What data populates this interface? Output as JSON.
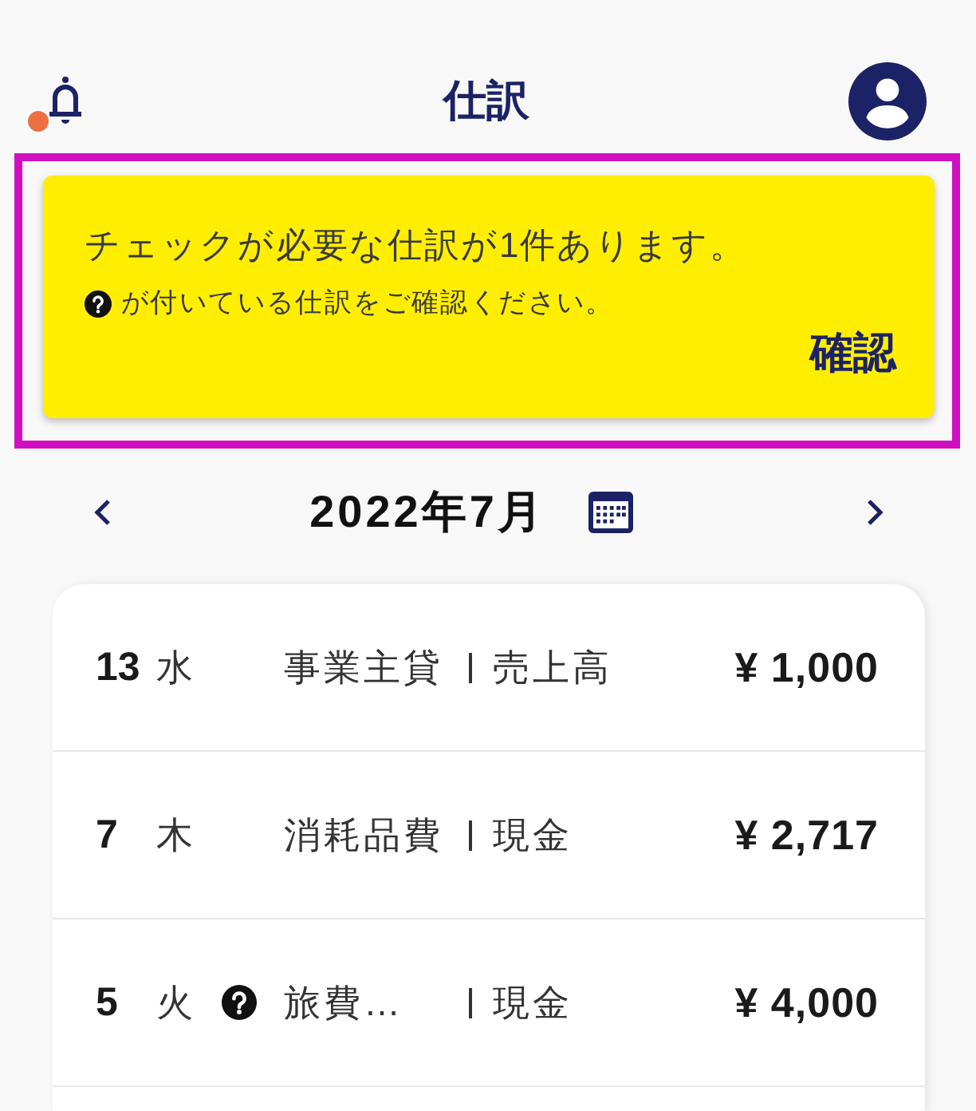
{
  "header": {
    "title": "仕訳",
    "has_notification": true
  },
  "banner": {
    "highlighted": true,
    "message": "チェックが必要な仕訳が1件あります。",
    "note": "が付いている仕訳をご確認ください。",
    "action": "確認"
  },
  "month_nav": {
    "label": "2022年7月"
  },
  "entries": [
    {
      "day": "13",
      "weekday": "水",
      "needs_check": false,
      "debit": "事業主貸",
      "credit": "売上高",
      "amount": "¥ 1,000"
    },
    {
      "day": "7",
      "weekday": "木",
      "needs_check": false,
      "debit": "消耗品費",
      "credit": "現金",
      "amount": "¥ 2,717"
    },
    {
      "day": "5",
      "weekday": "火",
      "needs_check": true,
      "debit": "旅費…",
      "credit": "現金",
      "amount": "¥ 4,000"
    }
  ]
}
